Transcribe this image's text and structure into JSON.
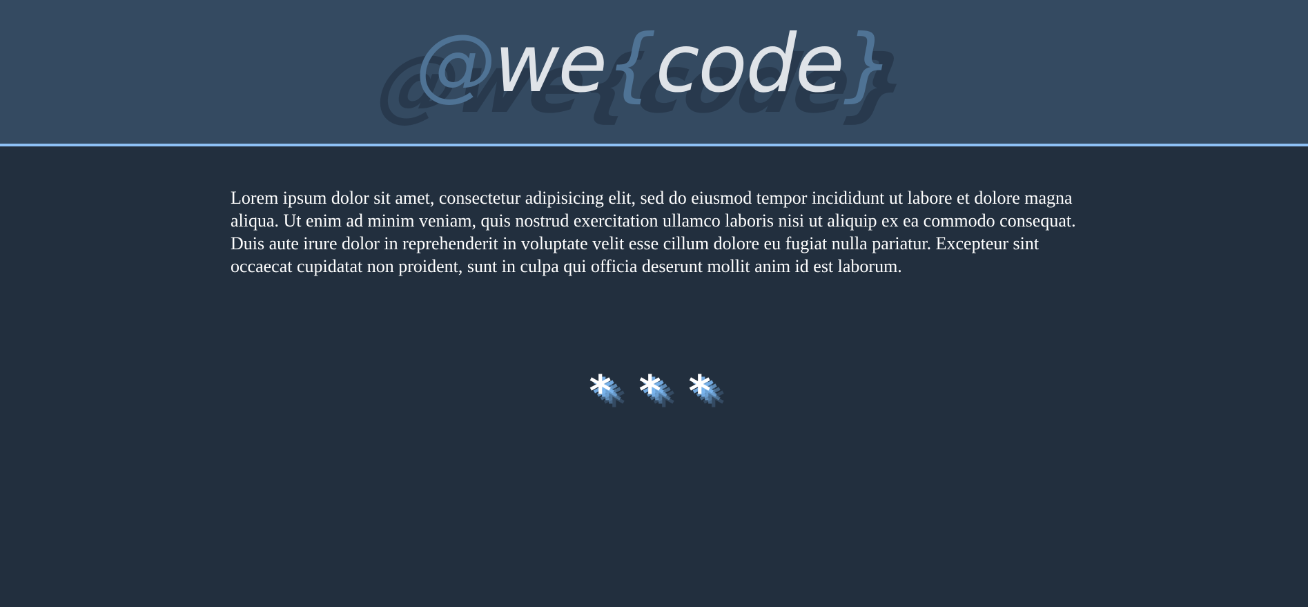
{
  "header": {
    "logo": {
      "at": "@",
      "we": "we",
      "open_brace": "{",
      "code": "code",
      "close_brace": "}"
    },
    "colors": {
      "background": "#344a61",
      "accent_border": "#8ec1f6",
      "logo_text": "#dfe3e8",
      "logo_symbols": "#4f7395"
    }
  },
  "main": {
    "paragraph": "Lorem ipsum dolor sit amet, consectetur adipisicing elit, sed do eiusmod tempor incididunt ut labore et dolore magna aliqua. Ut enim ad minim veniam, quis nostrud exercitation ullamco laboris nisi ut aliquip ex ea commodo consequat. Duis aute irure dolor in reprehenderit in voluptate velit esse cillum dolore eu fugiat nulla pariatur. Excepteur sint occaecat cupidatat non proident, sunt in culpa qui officia deserunt mollit anim id est laborum.",
    "divider": [
      "*",
      "*",
      "*"
    ],
    "colors": {
      "background": "#222f3e",
      "text": "#ffffff",
      "divider_glow": "#7cb8f2"
    }
  }
}
